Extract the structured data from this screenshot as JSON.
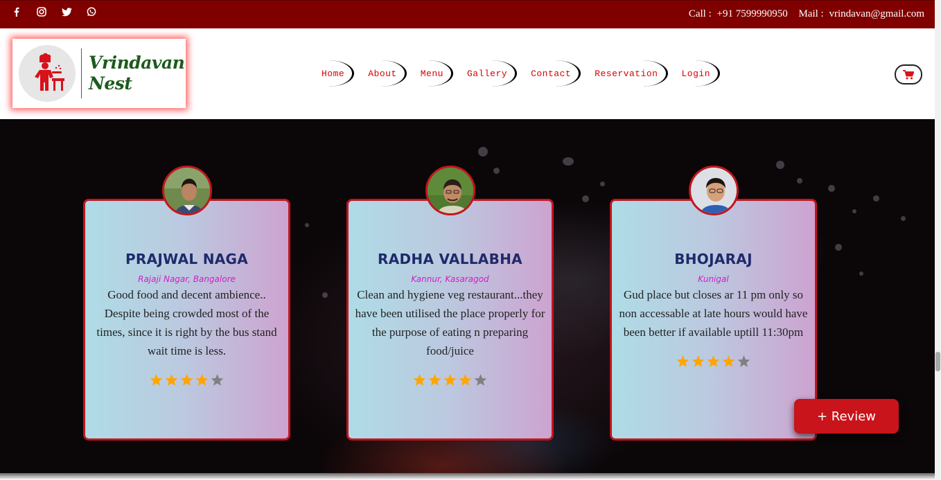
{
  "topbar": {
    "social_icons": [
      "facebook-icon",
      "instagram-icon",
      "twitter-icon",
      "whatsapp-icon"
    ],
    "call_label": "Call :",
    "phone": "+91 7599990950",
    "mail_label": "Mail :",
    "email": "vrindavan@gmail.com"
  },
  "brand": {
    "line1": "Vrindavan",
    "line2": "Nest"
  },
  "nav": {
    "items": [
      "Home",
      "About",
      "Menu",
      "Gallery",
      "Contact",
      "Reservation",
      "Login"
    ]
  },
  "cart": {
    "icon": "cart-icon"
  },
  "testimonials": [
    {
      "name": "PRAJWAL NAGA",
      "place": "Rajaji Nagar, Bangalore",
      "text": "Good food and decent ambience.. Despite being crowded most of the times, since it is right by the bus stand wait time is less.",
      "rating": 4,
      "max_rating": 5
    },
    {
      "name": "RADHA VALLABHA",
      "place": "Kannur, Kasaragod",
      "text": "Clean and hygiene veg restaurant...they have been utilised the place properly for the purpose of eating n preparing food/juice",
      "rating": 4,
      "max_rating": 5
    },
    {
      "name": "BHOJARAJ",
      "place": "Kunigal",
      "text": "Gud place but closes ar 11 pm only so non accessable at late hours would have been better if available uptill 11:30pm",
      "rating": 4,
      "max_rating": 5
    }
  ],
  "review_button": "+ Review",
  "colors": {
    "topbar": "#800000",
    "accent_red": "#c8141a",
    "nav_text": "#d90000",
    "name": "#1f2a6b",
    "place": "#d01dc8",
    "star_on": "#ffa500",
    "star_off": "#808080"
  }
}
